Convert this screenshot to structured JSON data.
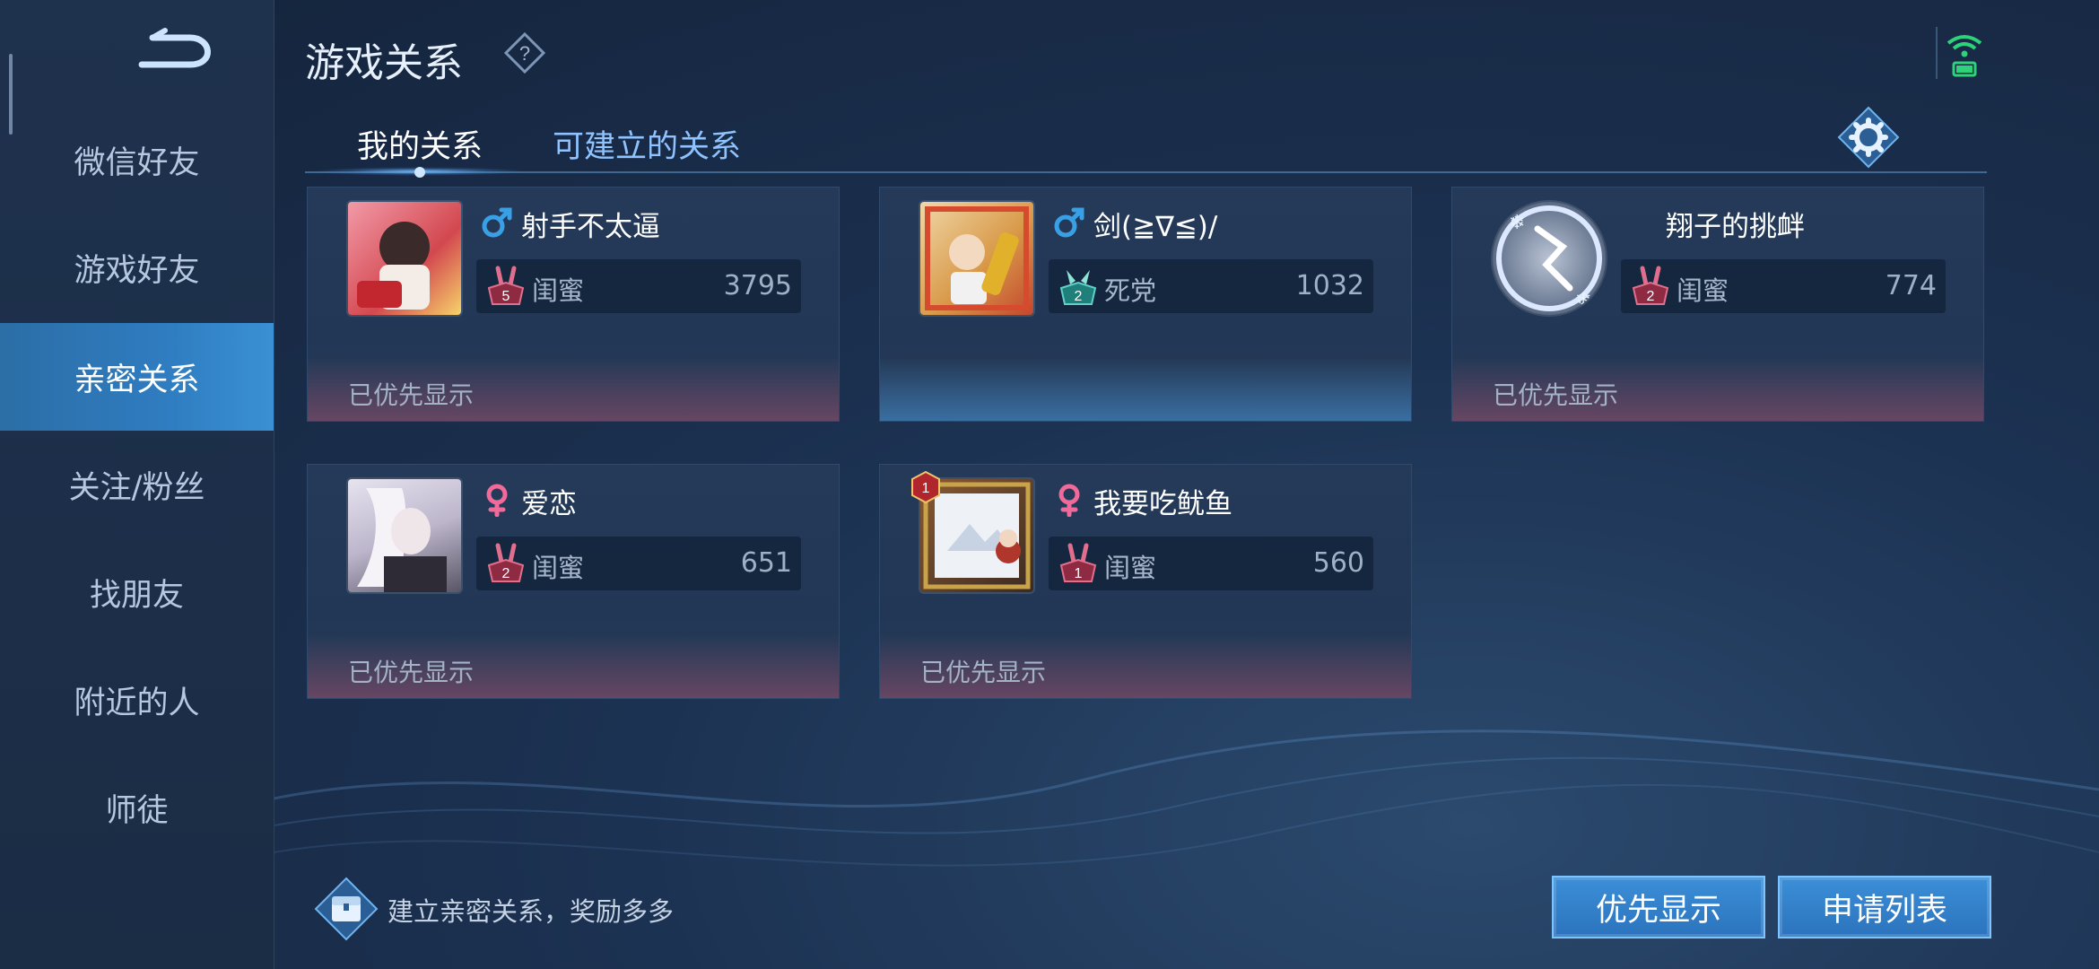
{
  "header": {
    "title": "游戏关系"
  },
  "sidebar": {
    "items": [
      {
        "label": "微信好友",
        "active": false
      },
      {
        "label": "游戏好友",
        "active": false
      },
      {
        "label": "亲密关系",
        "active": true
      },
      {
        "label": "关注/粉丝",
        "active": false
      },
      {
        "label": "找朋友",
        "active": false
      },
      {
        "label": "附近的人",
        "active": false
      },
      {
        "label": "师徒",
        "active": false
      }
    ]
  },
  "tabs": [
    {
      "label": "我的关系",
      "active": true
    },
    {
      "label": "可建立的关系",
      "active": false
    }
  ],
  "cards": [
    {
      "name": "射手不太逼",
      "gender": "male",
      "relation": "闺蜜",
      "level": "5",
      "score": "3795",
      "priority_text": "已优先显示",
      "priority": true
    },
    {
      "name": "剑(≧∇≦)/",
      "gender": "male",
      "relation": "死党",
      "level": "2",
      "score": "1032",
      "priority_text": "",
      "priority": false
    },
    {
      "name": "翔子的挑衅",
      "gender": "",
      "relation": "闺蜜",
      "level": "2",
      "score": "774",
      "priority_text": "已优先显示",
      "priority": true
    },
    {
      "name": "爱恋",
      "gender": "female",
      "relation": "闺蜜",
      "level": "2",
      "score": "651",
      "priority_text": "已优先显示",
      "priority": true
    },
    {
      "name": "我要吃鱿鱼",
      "gender": "female",
      "relation": "闺蜜",
      "level": "1",
      "score": "560",
      "priority_text": "已优先显示",
      "priority": true
    }
  ],
  "footer": {
    "hint": "建立亲密关系，奖励多多",
    "buttons": {
      "priority": "优先显示",
      "requests": "申请列表"
    }
  },
  "colors": {
    "accent": "#2f7cc0",
    "male": "#3aa0e6",
    "female": "#f06a9a",
    "bestie": "#c34a69",
    "buddy": "#2ea7a2"
  }
}
